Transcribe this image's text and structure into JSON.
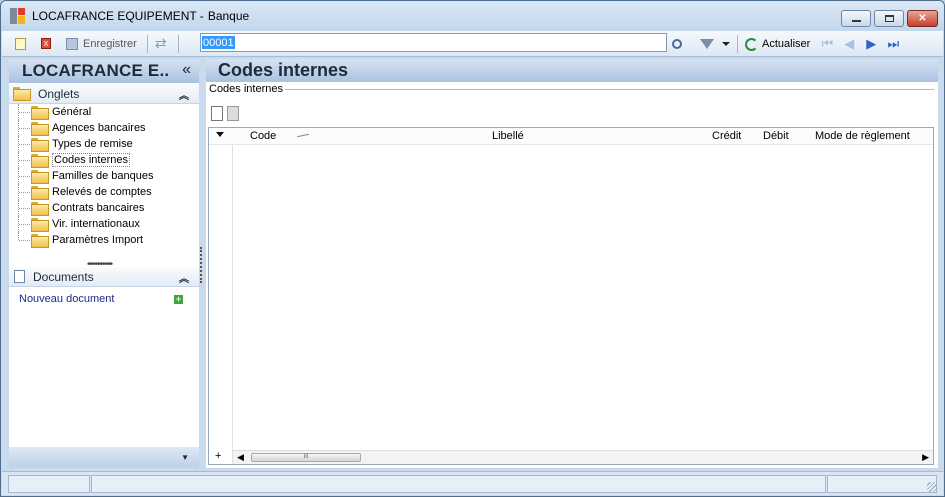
{
  "window": {
    "title": "LOCAFRANCE EQUIPEMENT -",
    "subtitle": "Banque",
    "buttons": {
      "minimize": "—",
      "maximize": "▢",
      "close": "✕"
    }
  },
  "toolbar": {
    "save_label": "Enregistrer",
    "search_value": "00001",
    "refresh_label": "Actualiser"
  },
  "left_panel": {
    "header": "LOCAFRANCE E..",
    "header_chevron": "«",
    "onglets": {
      "label": "Onglets",
      "items": [
        {
          "label": "Général"
        },
        {
          "label": "Agences bancaires"
        },
        {
          "label": "Types de remise"
        },
        {
          "label": "Codes internes"
        },
        {
          "label": "Familles de banques"
        },
        {
          "label": "Relevés de comptes"
        },
        {
          "label": "Contrats bancaires"
        },
        {
          "label": "Vir. internationaux"
        },
        {
          "label": "Paramètres Import"
        }
      ]
    },
    "documents": {
      "label": "Documents",
      "new_link": "Nouveau document"
    }
  },
  "content": {
    "title": "Codes internes",
    "fieldset_label": "Codes internes",
    "columns": [
      {
        "label": "Code"
      },
      {
        "label": "Libellé"
      },
      {
        "label": "Crédit"
      },
      {
        "label": "Débit"
      },
      {
        "label": "Mode de règlement"
      }
    ],
    "rows": []
  }
}
